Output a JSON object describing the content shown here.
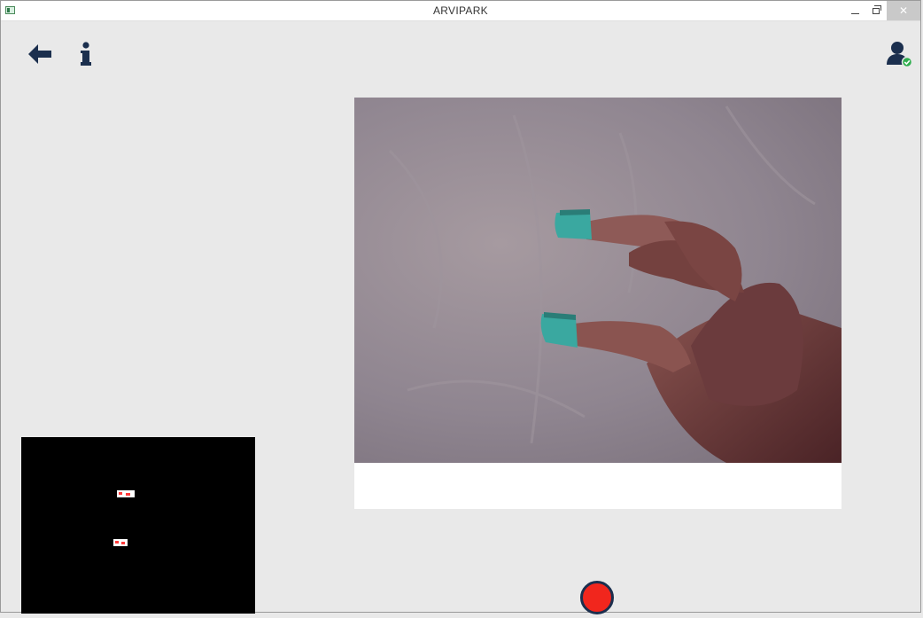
{
  "window": {
    "title": "ARVIPARK",
    "controls": [
      "minimize",
      "restore",
      "close"
    ]
  },
  "toolbar": {
    "back_icon": "arrow-left-icon",
    "info_icon": "info-icon",
    "user_icon": "user-check-icon",
    "icon_color": "#1b2f4e"
  },
  "camera": {
    "caption": "",
    "marker_color": "#3aa8a0"
  },
  "mask": {
    "blobs": 2
  },
  "record": {
    "color": "#f1261d"
  }
}
